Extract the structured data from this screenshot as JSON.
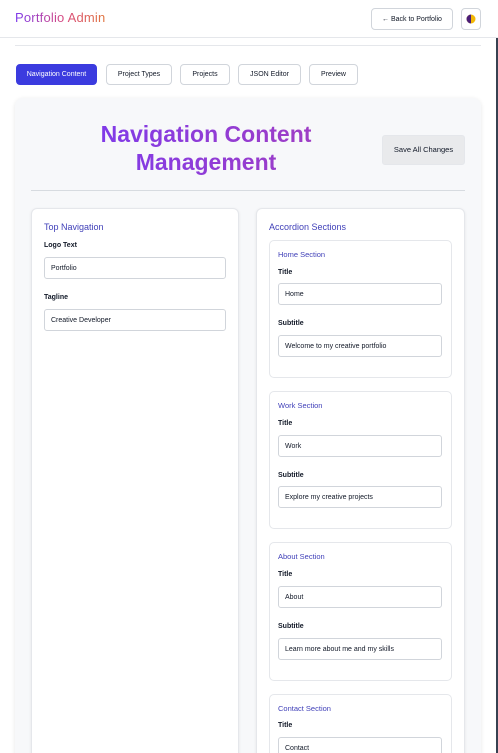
{
  "header": {
    "app_title": "Portfolio Admin",
    "back_label": "← Back to Portfolio",
    "theme_icon": "theme-toggle-icon"
  },
  "tabs": [
    {
      "label": "Navigation Content",
      "active": true
    },
    {
      "label": "Project Types",
      "active": false
    },
    {
      "label": "Projects",
      "active": false
    },
    {
      "label": "JSON Editor",
      "active": false
    },
    {
      "label": "Preview",
      "active": false
    }
  ],
  "page": {
    "title": "Navigation Content Management",
    "save_label": "Save All Changes"
  },
  "top_navigation": {
    "title": "Top Navigation",
    "logo_label": "Logo Text",
    "logo_value": "Portfolio",
    "tagline_label": "Tagline",
    "tagline_value": "Creative Developer"
  },
  "accordion": {
    "title": "Accordion Sections",
    "sections": [
      {
        "name": "Home Section",
        "title_label": "Title",
        "title_value": "Home",
        "subtitle_label": "Subtitle",
        "subtitle_value": "Welcome to my creative portfolio"
      },
      {
        "name": "Work Section",
        "title_label": "Title",
        "title_value": "Work",
        "subtitle_label": "Subtitle",
        "subtitle_value": "Explore my creative projects"
      },
      {
        "name": "About Section",
        "title_label": "Title",
        "title_value": "About",
        "subtitle_label": "Subtitle",
        "subtitle_value": "Learn more about me and my skills"
      },
      {
        "name": "Contact Section",
        "title_label": "Title",
        "title_value": "Contact"
      }
    ]
  },
  "colors": {
    "accent": "#3b3bdf",
    "title_gradient_start": "#7c3aed",
    "title_gradient_end": "#a33ec0",
    "section_heading": "#3f3fb8"
  }
}
